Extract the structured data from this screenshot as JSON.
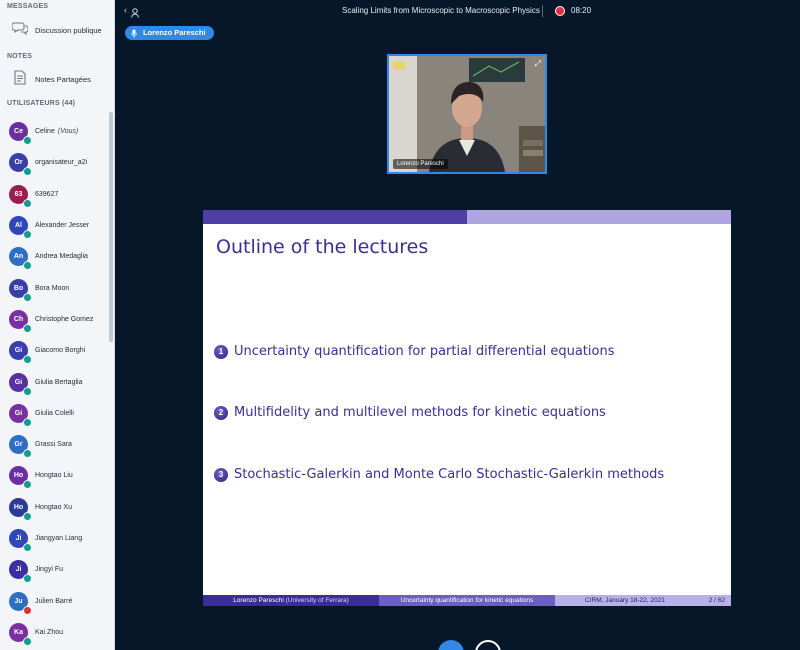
{
  "sidebar": {
    "messages_title": "MESSAGES",
    "public_chat_label": "Discussion publique",
    "notes_title": "NOTES",
    "shared_notes_label": "Notes Partagées",
    "users_title": "UTILISATEURS (44)",
    "users": [
      {
        "initials": "Ce",
        "name": "Celine",
        "suffix": "(Vous)",
        "color": "#6b2fa3",
        "badge_color": "#0f9d8f"
      },
      {
        "initials": "Or",
        "name": "organisateur_a2i",
        "suffix": "",
        "color": "#3a3ea8",
        "badge_color": "#0f9d8f"
      },
      {
        "initials": "63",
        "name": "639627",
        "suffix": "",
        "color": "#9a1f4f",
        "badge_color": "#0f9d8f"
      },
      {
        "initials": "Al",
        "name": "Alexander Jesser",
        "suffix": "",
        "color": "#2f47b8",
        "badge_color": "#0f9d8f"
      },
      {
        "initials": "An",
        "name": "Andrea Medaglia",
        "suffix": "",
        "color": "#2f6fc2",
        "badge_color": "#0f9d8f"
      },
      {
        "initials": "Bo",
        "name": "Bora Moon",
        "suffix": "",
        "color": "#3a3ea8",
        "badge_color": "#0f9d8f"
      },
      {
        "initials": "Ch",
        "name": "Christophe Gomez",
        "suffix": "",
        "color": "#7a2fa3",
        "badge_color": "#0f9d8f"
      },
      {
        "initials": "Gi",
        "name": "Giacomo Borghi",
        "suffix": "",
        "color": "#3a3ea8",
        "badge_color": "#0f9d8f"
      },
      {
        "initials": "Gi",
        "name": "Giulia Bertaglia",
        "suffix": "",
        "color": "#5a2fa3",
        "badge_color": "#0f9d8f"
      },
      {
        "initials": "Gi",
        "name": "Giulia Colelli",
        "suffix": "",
        "color": "#7a2fa3",
        "badge_color": "#0f9d8f"
      },
      {
        "initials": "Gr",
        "name": "Grassi Sara",
        "suffix": "",
        "color": "#2f6fc2",
        "badge_color": "#0f9d8f"
      },
      {
        "initials": "Ho",
        "name": "Hongtao Liu",
        "suffix": "",
        "color": "#6b2fa3",
        "badge_color": "#0f9d8f"
      },
      {
        "initials": "Ho",
        "name": "Hongtao Xu",
        "suffix": "",
        "color": "#2a3a96",
        "badge_color": "#0f9d8f"
      },
      {
        "initials": "Ji",
        "name": "Jiangyan Liang",
        "suffix": "",
        "color": "#2f47b8",
        "badge_color": "#0f9d8f"
      },
      {
        "initials": "Ji",
        "name": "Jingyi Fu",
        "suffix": "",
        "color": "#3a2fa3",
        "badge_color": "#0f9d8f"
      },
      {
        "initials": "Ju",
        "name": "Julien Barré",
        "suffix": "",
        "color": "#2f6fc2",
        "badge_color": "#e0303e"
      },
      {
        "initials": "Ka",
        "name": "Kai Zhou",
        "suffix": "",
        "color": "#7a2fa3",
        "badge_color": "#0f9d8f"
      }
    ]
  },
  "topbar": {
    "title": "Scaling Limits from Microscopic to Macroscopic Physics",
    "recording_time": "08:20",
    "rec_color": "#e0303e"
  },
  "presenter": {
    "pill_label": "Lorenzo Pareschi",
    "video_name": "Lorenzo Pareschi"
  },
  "slide": {
    "heading": "Outline of the lectures",
    "items": [
      {
        "num": "1",
        "text": "Uncertainty quantification for partial differential equations"
      },
      {
        "num": "2",
        "text": "Multifidelity and multilevel methods for kinetic equations"
      },
      {
        "num": "3",
        "text": "Stochastic-Galerkin and Monte Carlo Stochastic-Galerkin methods"
      }
    ],
    "footer_author": "Lorenzo Pareschi",
    "footer_affiliation": "(University of Ferrara)",
    "footer_topic": "Uncertainty quantification for kinetic equations",
    "footer_venue": "CIRM, January 18-22, 2021",
    "footer_page": "2 / 62",
    "accent_color": "#3a2e96"
  },
  "icons": {
    "back": "chevron-left-icon",
    "chat": "chat-bubbles-icon",
    "notes": "notes-icon",
    "mic": "microphone-icon",
    "expand": "fullscreen-icon",
    "record": "record-icon"
  }
}
